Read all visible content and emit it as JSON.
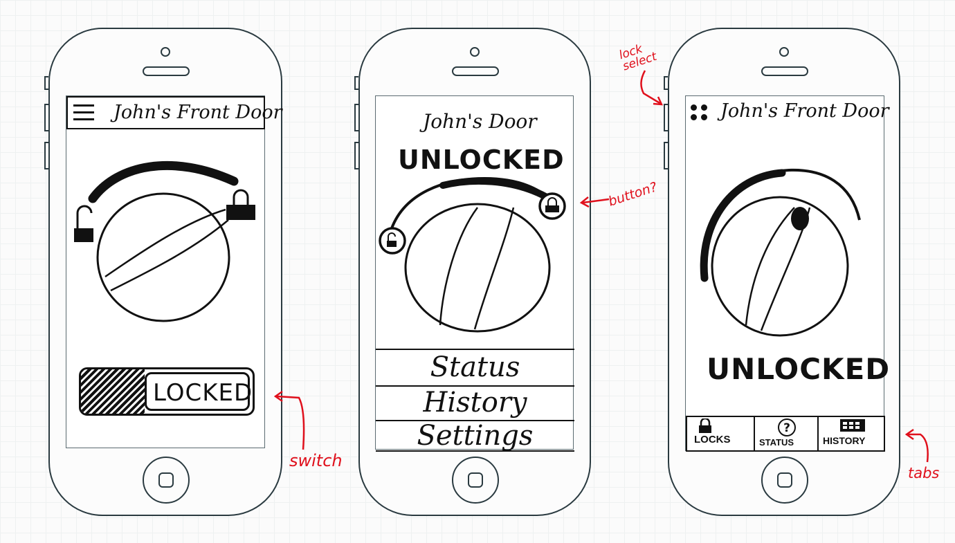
{
  "phone1": {
    "header_title": "John's Front Door",
    "menu_icon": "hamburger-icon",
    "switch_label": "LOCKED",
    "unlock_icon": "unlocked-padlock-icon",
    "lock_icon": "locked-padlock-icon"
  },
  "phone2": {
    "title": "John's Door",
    "status": "UNLOCKED",
    "menu": [
      "Status",
      "History",
      "Settings"
    ],
    "unlock_icon": "unlocked-padlock-icon",
    "lock_icon": "locked-padlock-icon"
  },
  "phone3": {
    "header_title": "John's Front Door",
    "lock_select_icon": "grid-dots-icon",
    "status": "UNLOCKED",
    "tabs": [
      {
        "label": "LOCKS",
        "icon": "padlock-icon"
      },
      {
        "label": "STATUS",
        "icon": "question-circle-icon"
      },
      {
        "label": "HISTORY",
        "icon": "calendar-icon"
      }
    ]
  },
  "annotations": {
    "switch": "switch",
    "button": "button?",
    "lock_select": "lock select",
    "tabs": "tabs"
  },
  "colors": {
    "ink": "#111111",
    "annotation": "#e0101c",
    "outline": "#2a3a40"
  }
}
